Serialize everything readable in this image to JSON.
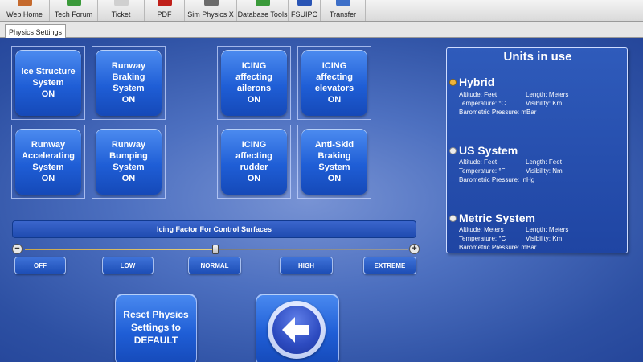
{
  "toolbar": {
    "items": [
      {
        "label": "Web Home",
        "icon": "home-icon",
        "color": "#c56a2e"
      },
      {
        "label": "Tech Forum",
        "icon": "people-icon",
        "color": "#3b9a3b"
      },
      {
        "label": "Ticket",
        "icon": "ticket-icon",
        "color": "#d0d0d0"
      },
      {
        "label": "PDF",
        "icon": "pdf-icon",
        "color": "#c0201a"
      },
      {
        "label": "Sim Physics X",
        "icon": "sim-physics-icon",
        "color": "#6b6b6b"
      },
      {
        "label": "Database Tools",
        "icon": "database-icon",
        "color": "#3a9a3a"
      },
      {
        "label": "FSUIPC",
        "icon": "fsuipc-icon",
        "color": "#2a55b5"
      },
      {
        "label": "Transfer",
        "icon": "transfer-icon",
        "color": "#3d6fc8"
      }
    ]
  },
  "tabs": [
    {
      "label": "Physics Settings"
    }
  ],
  "toggles": [
    {
      "label": "Ice Structure System",
      "state": "ON"
    },
    {
      "label": "Runway Braking System",
      "state": "ON"
    },
    {
      "label": "ICING affecting ailerons",
      "state": "ON"
    },
    {
      "label": "ICING affecting elevators",
      "state": "ON"
    },
    {
      "label": "Runway Accelerating System",
      "state": "ON"
    },
    {
      "label": "Runway Bumping System",
      "state": "ON"
    },
    {
      "label": "ICING affecting rudder",
      "state": "ON"
    },
    {
      "label": "Anti-Skid Braking System",
      "state": "ON"
    }
  ],
  "icing": {
    "title": "Icing Factor For Control Surfaces",
    "minus": "−",
    "plus": "+",
    "levels": [
      "OFF",
      "LOW",
      "NORMAL",
      "HIGH",
      "EXTREME"
    ],
    "selected_level": "NORMAL",
    "slider_value": 0.5
  },
  "reset_button": {
    "label": "Reset Physics Settings to DEFAULT"
  },
  "units": {
    "title": "Units in use",
    "selected": "Hybrid",
    "options": [
      {
        "name": "Hybrid",
        "altitude": "Altitude: Feet",
        "length": "Length: Meters",
        "temperature": "Temperature: °C",
        "visibility": "Visibility: Km",
        "pressure": "Barometric Pressure: mBar",
        "selected": true
      },
      {
        "name": "US System",
        "altitude": "Altitude: Feet",
        "length": "Length: Feet",
        "temperature": "Temperature: °F",
        "visibility": "Visibility: Nm",
        "pressure": "Barometric Pressure: InHg",
        "selected": false
      },
      {
        "name": "Metric System",
        "altitude": "Altitude: Meters",
        "length": "Length: Meters",
        "temperature": "Temperature: °C",
        "visibility": "Visibility: Km",
        "pressure": "Barometric Pressure: mBar",
        "selected": false
      }
    ]
  },
  "colors": {
    "accent": "#1f5ed6",
    "panel": "#2f5bbb",
    "selected_radio": "#f0b43a"
  }
}
